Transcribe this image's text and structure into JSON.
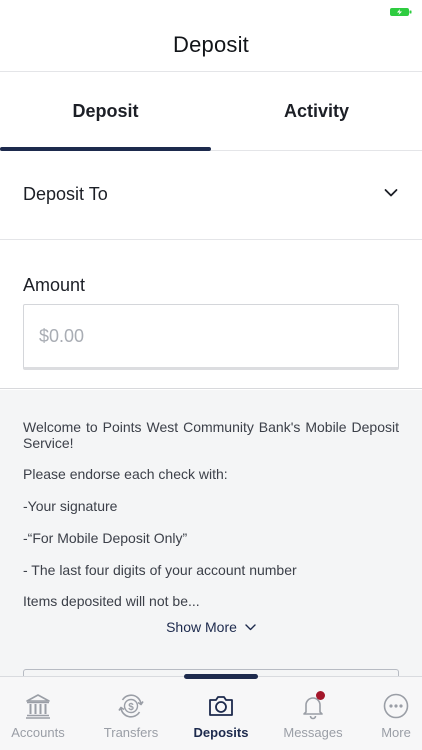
{
  "header": {
    "title": "Deposit"
  },
  "tabs": [
    {
      "label": "Deposit",
      "active": true
    },
    {
      "label": "Activity",
      "active": false
    }
  ],
  "deposit_to": {
    "label": "Deposit To"
  },
  "amount": {
    "label": "Amount",
    "placeholder": "$0.00",
    "value": ""
  },
  "info": {
    "welcome": "Welcome to Points West Community Bank's Mobile Deposit Service!",
    "endorse": "Please endorse each check with:",
    "signature": "-Your signature",
    "mobile_only": "-“For Mobile Deposit Only”",
    "last_four": "- The last four digits of your account number",
    "items": "Items deposited will not be...",
    "show_more": "Show More"
  },
  "bottom_nav": [
    {
      "label": "Accounts",
      "icon": "bank-icon",
      "active": false
    },
    {
      "label": "Transfers",
      "icon": "transfer-dollar-icon",
      "active": false
    },
    {
      "label": "Deposits",
      "icon": "camera-icon",
      "active": true
    },
    {
      "label": "Messages",
      "icon": "bell-icon",
      "active": false,
      "badge": true
    },
    {
      "label": "More",
      "icon": "more-dots-icon",
      "active": false
    }
  ],
  "colors": {
    "brand": "#1d2a4d",
    "badge": "#a4172b",
    "inactive": "#9a9ea6",
    "battery": "#2ecc40"
  }
}
